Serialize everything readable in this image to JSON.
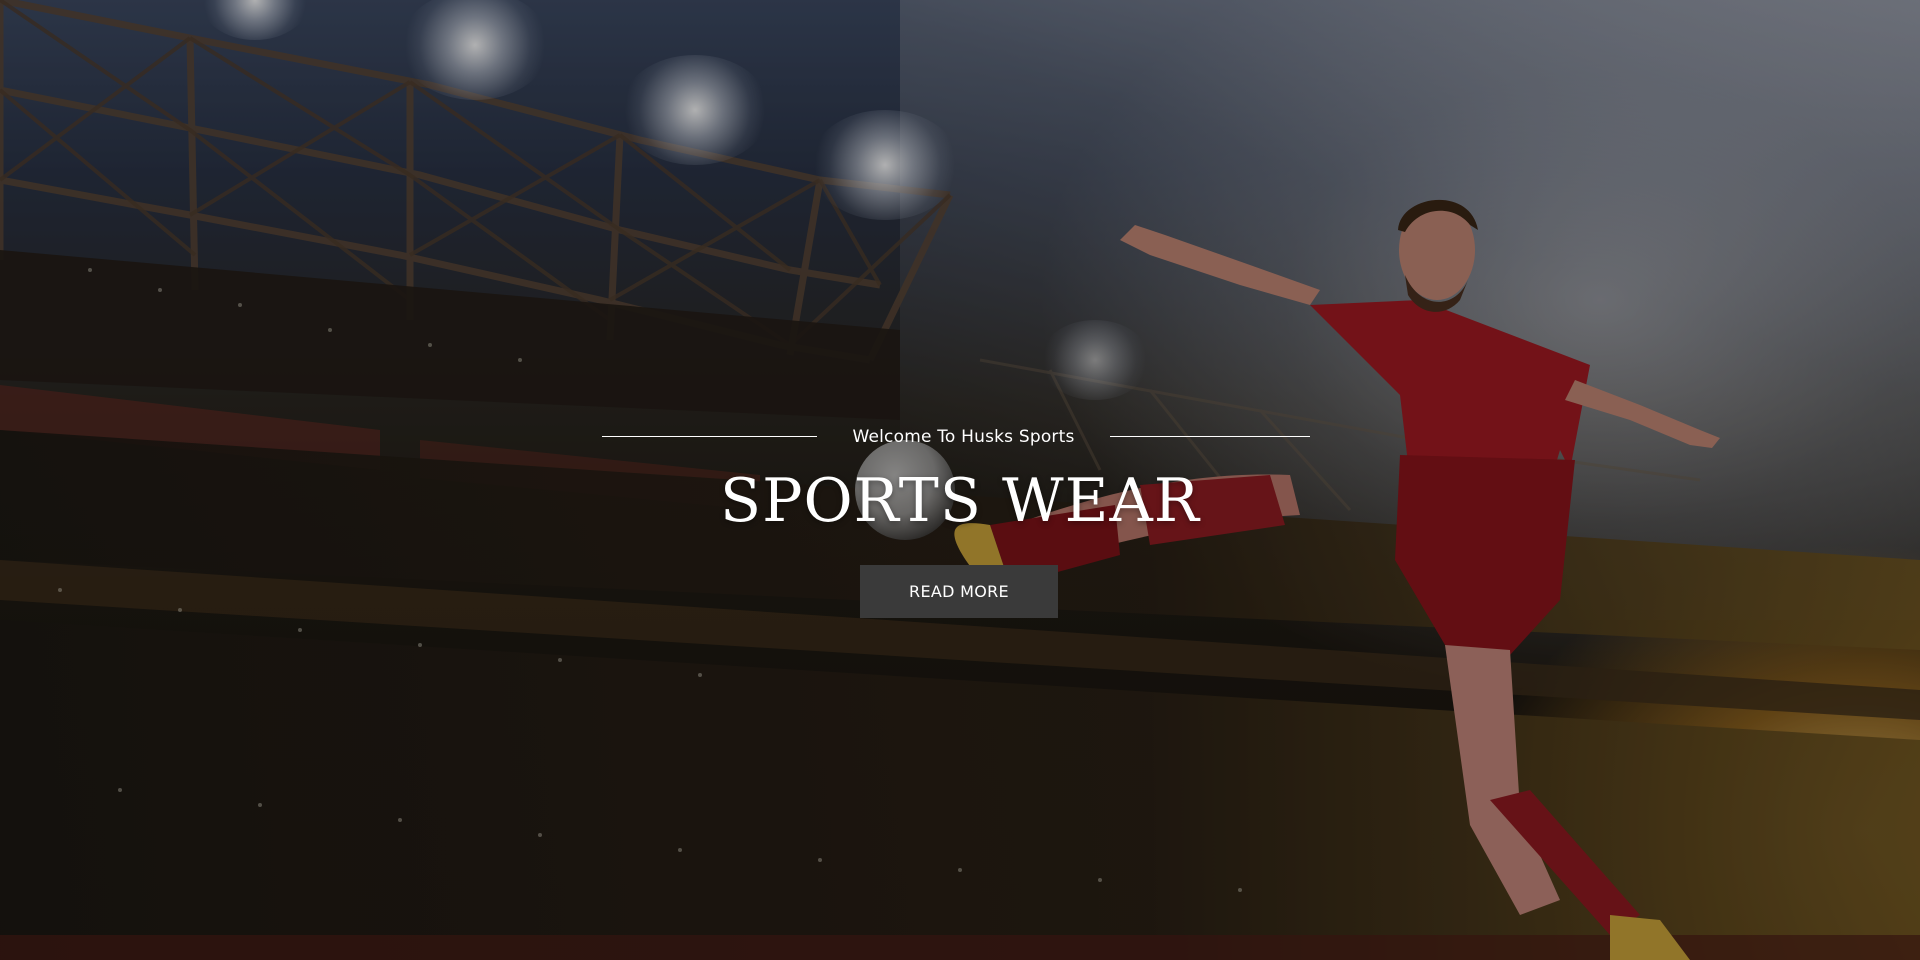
{
  "hero": {
    "welcome_text": "Welcome To Husks Sports",
    "title": "SPORTS WEAR",
    "cta_label": "READ MORE",
    "background_image": "stadium-football-player-kicking-ball"
  },
  "colors": {
    "text": "#ffffff",
    "button_bg": "#3a3a3a",
    "overlay": "rgba(0,0,0,0.28)"
  }
}
